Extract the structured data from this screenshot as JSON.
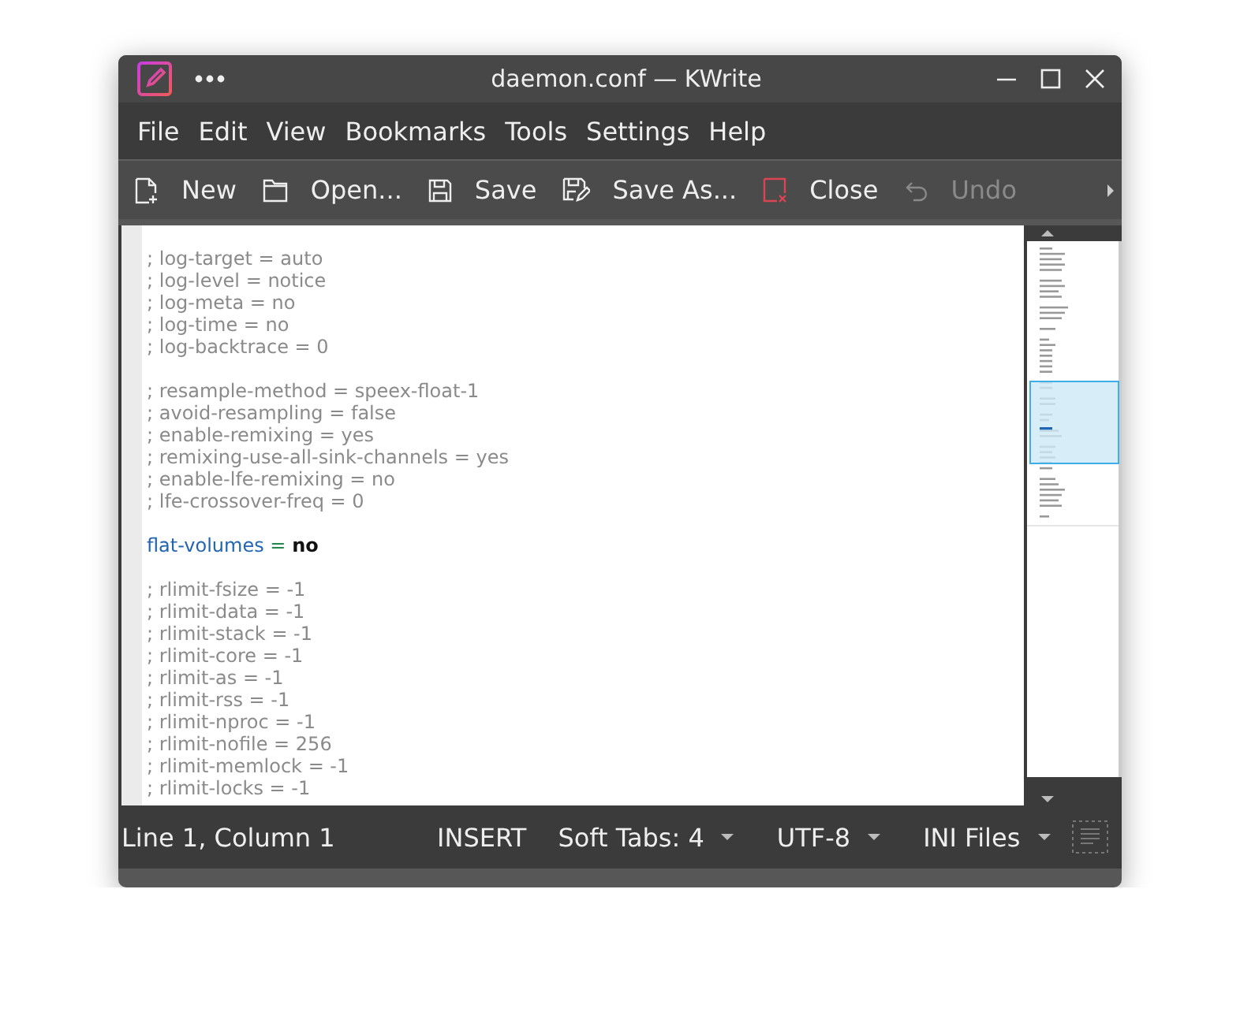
{
  "window": {
    "title": "daemon.conf — KWrite"
  },
  "menu": [
    "File",
    "Edit",
    "View",
    "Bookmarks",
    "Tools",
    "Settings",
    "Help"
  ],
  "toolbar": [
    {
      "kind": "new",
      "label": "New",
      "disabled": false
    },
    {
      "kind": "open",
      "label": "Open...",
      "disabled": false
    },
    {
      "kind": "save",
      "label": "Save",
      "disabled": false
    },
    {
      "kind": "saveas",
      "label": "Save As...",
      "disabled": false
    },
    {
      "kind": "close",
      "label": "Close",
      "disabled": false
    },
    {
      "kind": "undo",
      "label": "Undo",
      "disabled": true
    }
  ],
  "editor": {
    "lines": [
      {
        "kind": "blank"
      },
      {
        "kind": "comment",
        "text": "; log-target = auto"
      },
      {
        "kind": "comment",
        "text": "; log-level = notice"
      },
      {
        "kind": "comment",
        "text": "; log-meta = no"
      },
      {
        "kind": "comment",
        "text": "; log-time = no"
      },
      {
        "kind": "comment",
        "text": "; log-backtrace = 0"
      },
      {
        "kind": "blank"
      },
      {
        "kind": "comment",
        "text": "; resample-method = speex-float-1"
      },
      {
        "kind": "comment",
        "text": "; avoid-resampling = false"
      },
      {
        "kind": "comment",
        "text": "; enable-remixing = yes"
      },
      {
        "kind": "comment",
        "text": "; remixing-use-all-sink-channels = yes"
      },
      {
        "kind": "comment",
        "text": "; enable-lfe-remixing = no"
      },
      {
        "kind": "comment",
        "text": "; lfe-crossover-freq = 0"
      },
      {
        "kind": "blank"
      },
      {
        "kind": "setting",
        "key": "flat-volumes",
        "op": "=",
        "value": "no"
      },
      {
        "kind": "blank"
      },
      {
        "kind": "comment",
        "text": "; rlimit-fsize = -1"
      },
      {
        "kind": "comment",
        "text": "; rlimit-data = -1"
      },
      {
        "kind": "comment",
        "text": "; rlimit-stack = -1"
      },
      {
        "kind": "comment",
        "text": "; rlimit-core = -1"
      },
      {
        "kind": "comment",
        "text": "; rlimit-as = -1"
      },
      {
        "kind": "comment",
        "text": "; rlimit-rss = -1"
      },
      {
        "kind": "comment",
        "text": "; rlimit-nproc = -1"
      },
      {
        "kind": "comment",
        "text": "; rlimit-nofile = 256"
      },
      {
        "kind": "comment",
        "text": "; rlimit-memlock = -1"
      },
      {
        "kind": "comment",
        "text": "; rlimit-locks = -1"
      }
    ]
  },
  "status_bar": {
    "position": "Line 1, Column 1",
    "mode": "INSERT",
    "dropdowns": [
      "Soft Tabs: 4",
      "UTF-8",
      "INI Files"
    ]
  }
}
